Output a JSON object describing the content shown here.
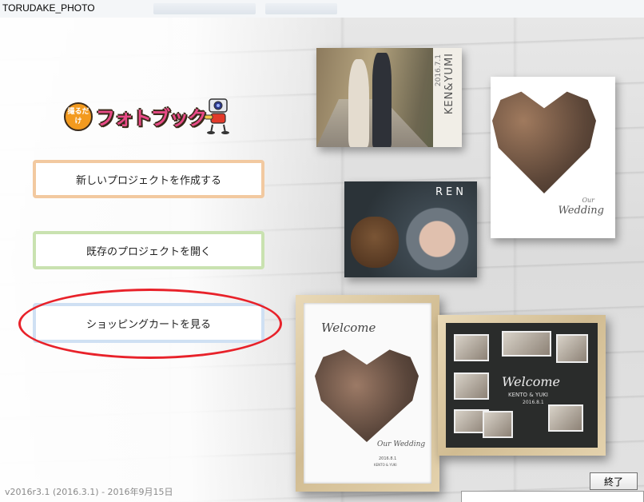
{
  "window": {
    "title": "TORUDAKE_PHOTO"
  },
  "logo": {
    "badge_text": "撮るだけ",
    "text": "フォトブック"
  },
  "menu": {
    "new_project": "新しいプロジェクトを作成する",
    "open_project": "既存のプロジェクトを開く",
    "shopping_cart": "ショッピングカートを見る"
  },
  "footer": {
    "version": "v2016r3.1 (2016.3.1) - 2016年9月15日",
    "quit_label": "終了"
  },
  "samples": {
    "couple_title": "KEN&YUMI",
    "couple_date": "2016.7.1",
    "baby_title": "REN",
    "heart_script_small": "Our",
    "heart_script": "Wedding",
    "welcome_title": "Welcome",
    "welcome_script": "Our Wedding",
    "welcome_date": "2016.8.1",
    "welcome_names": "KENTO & YUKI",
    "chalk_title": "Welcome",
    "chalk_names": "KENTO & YUKI",
    "chalk_date": "2016.8.1"
  },
  "colors": {
    "new_border": "#f2c9a0",
    "open_border": "#c9e2b0",
    "shop_border": "#cfe0f3",
    "highlight_circle": "#e8222a"
  }
}
